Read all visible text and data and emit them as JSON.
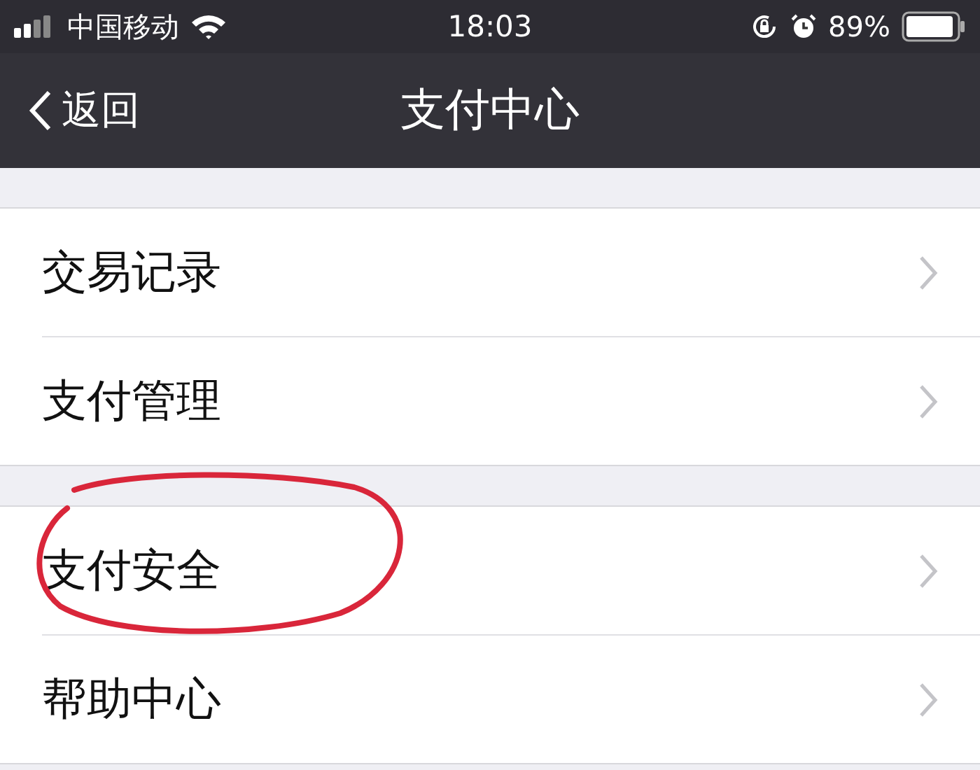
{
  "status_bar": {
    "carrier": "中国移动",
    "time": "18:03",
    "battery_percent": "89%"
  },
  "nav_bar": {
    "back": "返回",
    "title": "支付中心"
  },
  "groups": [
    {
      "items": [
        {
          "label": "交易记录",
          "circled": false
        },
        {
          "label": "支付管理",
          "circled": false
        }
      ]
    },
    {
      "items": [
        {
          "label": "支付安全",
          "circled": true
        },
        {
          "label": "帮助中心",
          "circled": false
        }
      ]
    }
  ]
}
